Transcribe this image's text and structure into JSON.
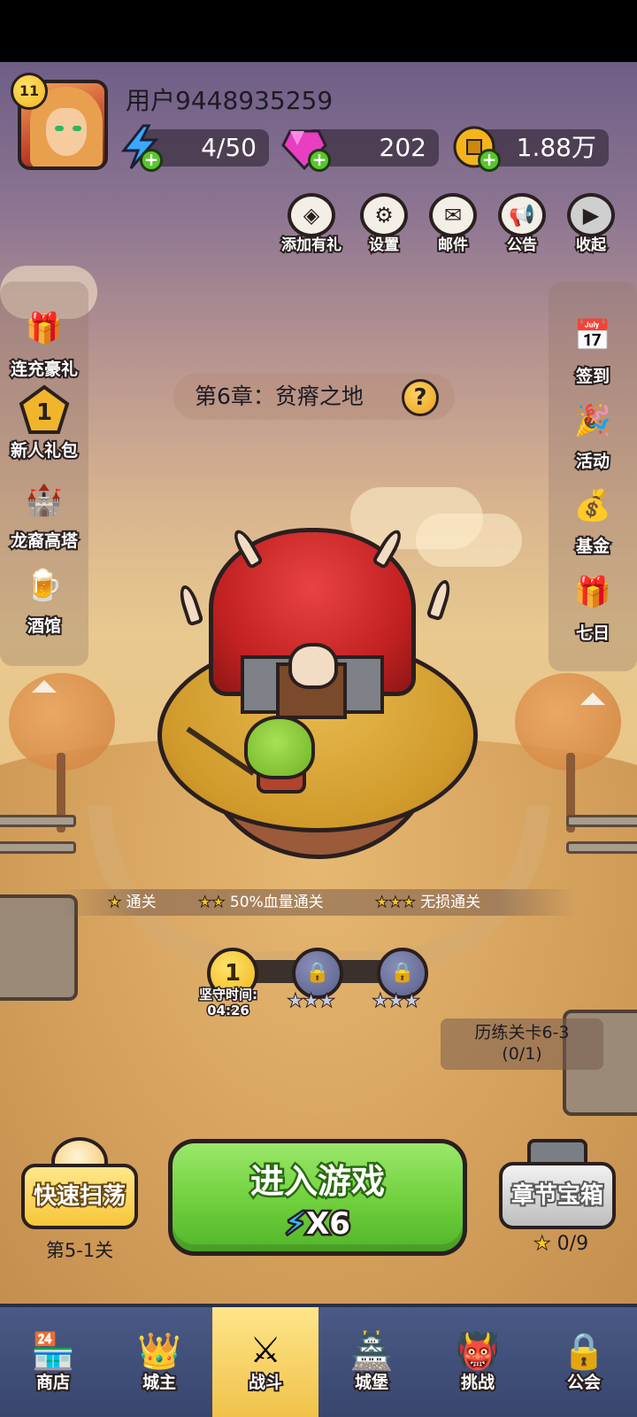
{
  "user": {
    "name": "用户9448935259",
    "level": "11"
  },
  "resources": {
    "energy": "4/50",
    "gems": "202",
    "gold": "1.88万"
  },
  "top_buttons": [
    {
      "label": "添加有礼",
      "icon": "diamond-gift-icon"
    },
    {
      "label": "设置",
      "icon": "gear-icon"
    },
    {
      "label": "邮件",
      "icon": "mail-icon"
    },
    {
      "label": "公告",
      "icon": "megaphone-icon"
    },
    {
      "label": "收起",
      "icon": "collapse-play-icon"
    }
  ],
  "left_menu": [
    {
      "label": "连充豪礼",
      "icon": "gift-box-icon"
    },
    {
      "label": "新人礼包",
      "icon": "newbie-pack-icon",
      "badge": "1"
    },
    {
      "label": "龙裔高塔",
      "icon": "tower-icon"
    },
    {
      "label": "酒馆",
      "icon": "beer-mug-icon"
    }
  ],
  "right_menu": [
    {
      "label": "签到",
      "icon": "calendar-icon"
    },
    {
      "label": "活动",
      "icon": "event-gift-icon"
    },
    {
      "label": "基金",
      "icon": "money-bag-icon"
    },
    {
      "label": "七日",
      "icon": "seven-day-gift-icon"
    }
  ],
  "chapter": {
    "title": "第6章：贫瘠之地",
    "help": "?"
  },
  "conditions": [
    {
      "stars": "★",
      "label": "通关"
    },
    {
      "stars": "★★",
      "label": "50%血量通关"
    },
    {
      "stars": "★★★",
      "label": "无损通关"
    }
  ],
  "stages": {
    "current_number": "1",
    "hold_time_label": "坚守时间:",
    "hold_time": "04:26",
    "node_stars": "★★★"
  },
  "training": {
    "label": "历练关卡6-3",
    "progress": "(0/1)"
  },
  "actions": {
    "sweep_label": "快速扫荡",
    "sweep_stage": "第5-1关",
    "play_label": "进入游戏",
    "play_cost": "X6",
    "chest_label": "章节宝箱",
    "chest_stars": "0/9"
  },
  "bottom_nav": [
    {
      "label": "商店",
      "icon": "shop-icon"
    },
    {
      "label": "城主",
      "icon": "crown-icon"
    },
    {
      "label": "战斗",
      "icon": "crossed-swords-icon",
      "active": true
    },
    {
      "label": "城堡",
      "icon": "castle-icon"
    },
    {
      "label": "挑战",
      "icon": "demon-icon"
    },
    {
      "label": "公会",
      "icon": "locked-guild-icon"
    }
  ],
  "colors": {
    "play_button": "#6fcf3c",
    "active_tab": "#f0c24a",
    "nav_bg": "#4a5a86"
  }
}
